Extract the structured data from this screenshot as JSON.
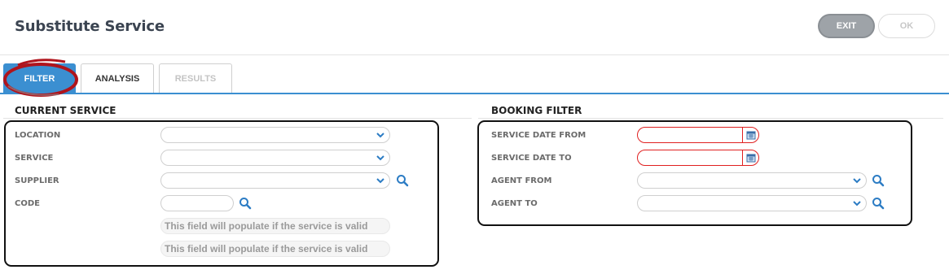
{
  "header": {
    "title": "Substitute Service",
    "exit_label": "EXIT",
    "ok_label": "OK"
  },
  "tabs": [
    {
      "label": "FILTER",
      "state": "active"
    },
    {
      "label": "ANALYSIS",
      "state": "enabled"
    },
    {
      "label": "RESULTS",
      "state": "disabled"
    }
  ],
  "current_service": {
    "title": "CURRENT SERVICE",
    "location_label": "LOCATION",
    "location_value": "",
    "service_label": "SERVICE",
    "service_value": "",
    "supplier_label": "SUPPLIER",
    "supplier_value": "",
    "code_label": "CODE",
    "code_value": "",
    "info_line_1": "This field will populate if the service is valid",
    "info_line_2": "This field will populate if the service is valid"
  },
  "booking_filter": {
    "title": "BOOKING FILTER",
    "date_from_label": "SERVICE DATE FROM",
    "date_from_value": "",
    "date_to_label": "SERVICE DATE TO",
    "date_to_value": "",
    "agent_from_label": "AGENT FROM",
    "agent_from_value": "",
    "agent_to_label": "AGENT TO",
    "agent_to_value": ""
  },
  "colors": {
    "accent": "#3b8fd1",
    "required_border": "#e02020",
    "annotation": "#b0141c"
  },
  "icons": [
    "chevron-down-icon",
    "search-icon",
    "calendar-icon"
  ]
}
